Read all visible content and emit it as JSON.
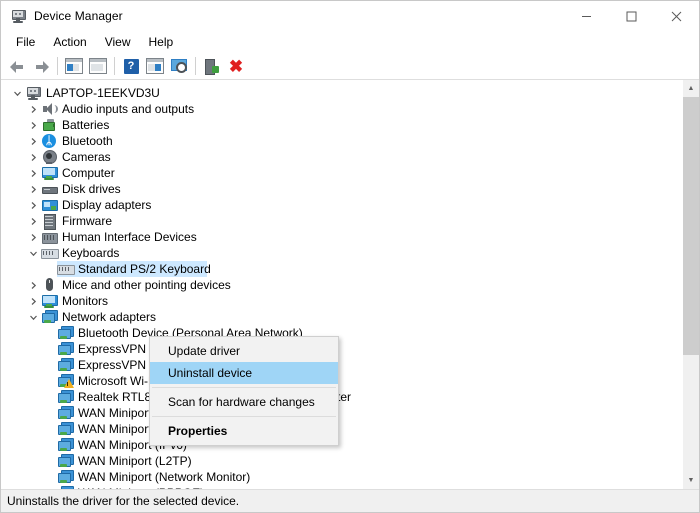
{
  "window": {
    "title": "Device Manager",
    "icon": "device-manager-icon",
    "controls": {
      "minimize": "—",
      "maximize": "□",
      "close": "✕"
    }
  },
  "menubar": {
    "items": [
      {
        "label": "File"
      },
      {
        "label": "Action"
      },
      {
        "label": "View"
      },
      {
        "label": "Help"
      }
    ]
  },
  "toolbar": {
    "buttons": [
      {
        "name": "back-arrow-icon",
        "tooltip": "Back"
      },
      {
        "name": "forward-arrow-icon",
        "tooltip": "Forward"
      },
      {
        "name": "show-hide-console-tree-icon",
        "tooltip": "Show/Hide Console Tree"
      },
      {
        "name": "properties-window-icon",
        "tooltip": "Properties"
      },
      {
        "name": "help-icon",
        "tooltip": "Help",
        "glyph": "?"
      },
      {
        "name": "show-hide-action-pane-icon",
        "tooltip": "Show/Hide Action Pane"
      },
      {
        "name": "scan-for-hardware-changes-icon",
        "tooltip": "Scan for hardware changes"
      },
      {
        "name": "update-driver-icon",
        "tooltip": "Update driver"
      },
      {
        "name": "uninstall-device-icon",
        "tooltip": "Uninstall device",
        "glyph": "✖"
      }
    ]
  },
  "tree": {
    "root": {
      "label": "LAPTOP-1EEKVD3U",
      "icon": "computer-icon",
      "expanded": true
    },
    "items": [
      {
        "label": "Audio inputs and outputs",
        "icon": "speaker-icon",
        "level": 1,
        "state": "collapsed"
      },
      {
        "label": "Batteries",
        "icon": "battery-icon",
        "level": 1,
        "state": "collapsed"
      },
      {
        "label": "Bluetooth",
        "icon": "bluetooth-icon",
        "level": 1,
        "state": "collapsed"
      },
      {
        "label": "Cameras",
        "icon": "camera-icon",
        "level": 1,
        "state": "collapsed"
      },
      {
        "label": "Computer",
        "icon": "monitor-icon",
        "level": 1,
        "state": "collapsed"
      },
      {
        "label": "Disk drives",
        "icon": "disk-drive-icon",
        "level": 1,
        "state": "collapsed"
      },
      {
        "label": "Display adapters",
        "icon": "display-adapter-icon",
        "level": 1,
        "state": "collapsed"
      },
      {
        "label": "Firmware",
        "icon": "firmware-icon",
        "level": 1,
        "state": "collapsed"
      },
      {
        "label": "Human Interface Devices",
        "icon": "hid-icon",
        "level": 1,
        "state": "collapsed"
      },
      {
        "label": "Keyboards",
        "icon": "keyboard-icon",
        "level": 1,
        "state": "expanded"
      },
      {
        "label": "Standard PS/2 Keyboard",
        "icon": "keyboard-icon",
        "level": 2,
        "state": "leaf",
        "selected": true
      },
      {
        "label": "Mice and other pointing devices",
        "icon": "mouse-icon",
        "level": 1,
        "state": "collapsed"
      },
      {
        "label": "Monitors",
        "icon": "monitor-icon",
        "level": 1,
        "state": "collapsed"
      },
      {
        "label": "Network adapters",
        "icon": "network-adapter-icon",
        "level": 1,
        "state": "expanded"
      },
      {
        "label": "Bluetooth Device (Personal Area Network)",
        "icon": "network-adapter-icon",
        "level": 2,
        "state": "leaf"
      },
      {
        "label": "ExpressVPN TAP Adapter",
        "icon": "network-adapter-icon",
        "level": 2,
        "state": "leaf"
      },
      {
        "label": "ExpressVPN Wintun Driver",
        "icon": "network-adapter-icon",
        "level": 2,
        "state": "leaf"
      },
      {
        "label": "Microsoft Wi-Fi Direct Virtual Adapter #2",
        "icon": "network-adapter-icon",
        "level": 2,
        "state": "leaf",
        "warning": true
      },
      {
        "label": "Realtek RTL8852AE WiFi 6 802.11ax PCIe Adapter",
        "icon": "network-adapter-icon",
        "level": 2,
        "state": "leaf"
      },
      {
        "label": "WAN Miniport (IKEv2)",
        "icon": "network-adapter-icon",
        "level": 2,
        "state": "leaf"
      },
      {
        "label": "WAN Miniport (IP)",
        "icon": "network-adapter-icon",
        "level": 2,
        "state": "leaf"
      },
      {
        "label": "WAN Miniport (IPv6)",
        "icon": "network-adapter-icon",
        "level": 2,
        "state": "leaf"
      },
      {
        "label": "WAN Miniport (L2TP)",
        "icon": "network-adapter-icon",
        "level": 2,
        "state": "leaf"
      },
      {
        "label": "WAN Miniport (Network Monitor)",
        "icon": "network-adapter-icon",
        "level": 2,
        "state": "leaf"
      },
      {
        "label": "WAN Miniport (PPPOE)",
        "icon": "network-adapter-icon",
        "level": 2,
        "state": "leaf"
      }
    ]
  },
  "context_menu": {
    "items": [
      {
        "label": "Update driver",
        "type": "item",
        "highlighted": false,
        "bold": false
      },
      {
        "label": "Uninstall device",
        "type": "item",
        "highlighted": true,
        "bold": false
      },
      {
        "type": "separator"
      },
      {
        "label": "Scan for hardware changes",
        "type": "item",
        "highlighted": false,
        "bold": false
      },
      {
        "type": "separator"
      },
      {
        "label": "Properties",
        "type": "item",
        "highlighted": false,
        "bold": true
      }
    ]
  },
  "statusbar": {
    "text": "Uninstalls the driver for the selected device."
  },
  "scrollbar": {
    "up_arrow": "▲",
    "down_arrow": "▼"
  },
  "colors": {
    "selection_blue": "#cde8ff",
    "menu_highlight": "#9fd5f6",
    "menu_bg": "#f2f2f2",
    "statusbar_bg": "#f0f0f0",
    "uninstall_red": "#e02020"
  }
}
